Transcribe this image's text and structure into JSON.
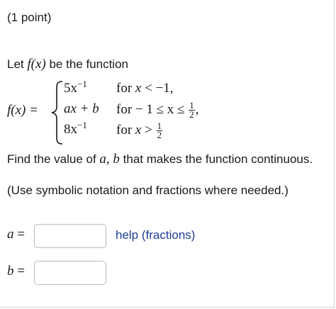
{
  "header": {
    "points_label": "(1 point)"
  },
  "intro": {
    "text_before": "Let ",
    "f_of_x": "f(x)",
    "text_after": " be the function"
  },
  "piecewise": {
    "lhs": "f(x) =",
    "cases": [
      {
        "expr_base": "5x",
        "expr_sup": "−1",
        "cond_prefix": "for ",
        "cond_var": "x",
        "cond_rest": " < −1,",
        "frac_num": "",
        "frac_den": "",
        "cond_suffix": ""
      },
      {
        "expr_base": "ax + b",
        "expr_sup": "",
        "cond_prefix": "for ",
        "cond_var": "",
        "cond_rest": " − 1 ≤ x ≤ ",
        "frac_num": "1",
        "frac_den": "2",
        "cond_suffix": ","
      },
      {
        "expr_base": "8x",
        "expr_sup": "−1",
        "cond_prefix": "for ",
        "cond_var": "x",
        "cond_rest": " > ",
        "frac_num": "1",
        "frac_den": "2",
        "cond_suffix": ""
      }
    ]
  },
  "question": {
    "find_before": "Find the value of ",
    "var_a": "a",
    "comma": ", ",
    "var_b": "b",
    "find_after": " that makes the function continuous.",
    "note": "(Use symbolic notation and fractions where needed.)"
  },
  "answers": {
    "a_label": "a =",
    "a_value": "",
    "b_label": "b =",
    "b_value": "",
    "help_link": "help (fractions)"
  },
  "colors": {
    "link": "#1f3d99",
    "input_border": "#b8b8b8",
    "text": "#1a1a1a"
  }
}
